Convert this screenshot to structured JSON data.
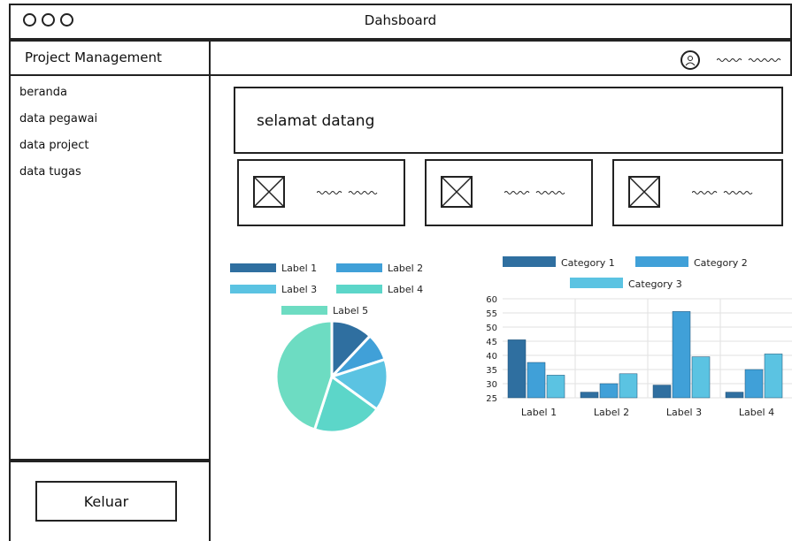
{
  "window": {
    "title": "Dahsboard"
  },
  "sidebar": {
    "brand": "Project Management",
    "items": [
      {
        "label": "beranda"
      },
      {
        "label": "data pegawai"
      },
      {
        "label": "data project"
      },
      {
        "label": "data tugas"
      }
    ],
    "logout_label": "Keluar"
  },
  "main": {
    "welcome": "selamat datang",
    "cards": 3
  },
  "colors": {
    "c1": "#2f6fa0",
    "c2": "#40a0d8",
    "c3": "#5bc3e2",
    "c4": "#5cd6c9",
    "c5": "#6ddcc2"
  },
  "chart_data": [
    {
      "type": "pie",
      "labels": [
        "Label 1",
        "Label 2",
        "Label 3",
        "Label 4",
        "Label 5"
      ],
      "values": [
        12,
        8,
        15,
        20,
        45
      ],
      "legend_position": "top"
    },
    {
      "type": "bar",
      "categories": [
        "Label 1",
        "Label 2",
        "Label 3",
        "Label 4"
      ],
      "series": [
        {
          "name": "Category 1",
          "values": [
            45.5,
            27,
            29.5,
            27
          ]
        },
        {
          "name": "Category 2",
          "values": [
            37.5,
            30,
            55.5,
            35
          ]
        },
        {
          "name": "Category 3",
          "values": [
            33,
            33.5,
            39.5,
            40.5
          ]
        }
      ],
      "yticks": [
        "25",
        "30",
        "35",
        "40",
        "45",
        "50",
        "55",
        "60"
      ],
      "ylim": [
        25,
        60
      ],
      "legend_position": "top",
      "grid": true
    }
  ]
}
